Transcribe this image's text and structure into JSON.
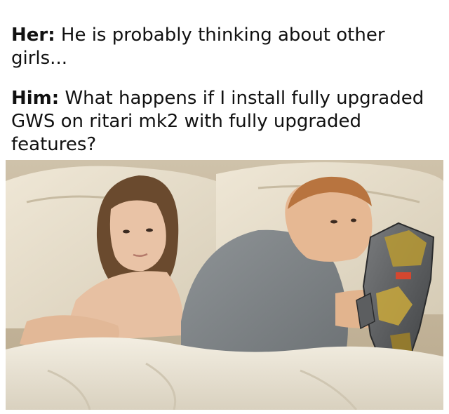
{
  "captions": {
    "her_speaker": "Her:",
    "her_text": "He is probably thinking about other girls...",
    "him_speaker": "Him:",
    "him_text": "What happens if I install fully upgraded GWS on ritari mk2 with fully upgraded features?"
  },
  "image": {
    "subject_left": "woman-icon",
    "subject_right": "man-icon",
    "held_object": "robot-mech-icon"
  }
}
